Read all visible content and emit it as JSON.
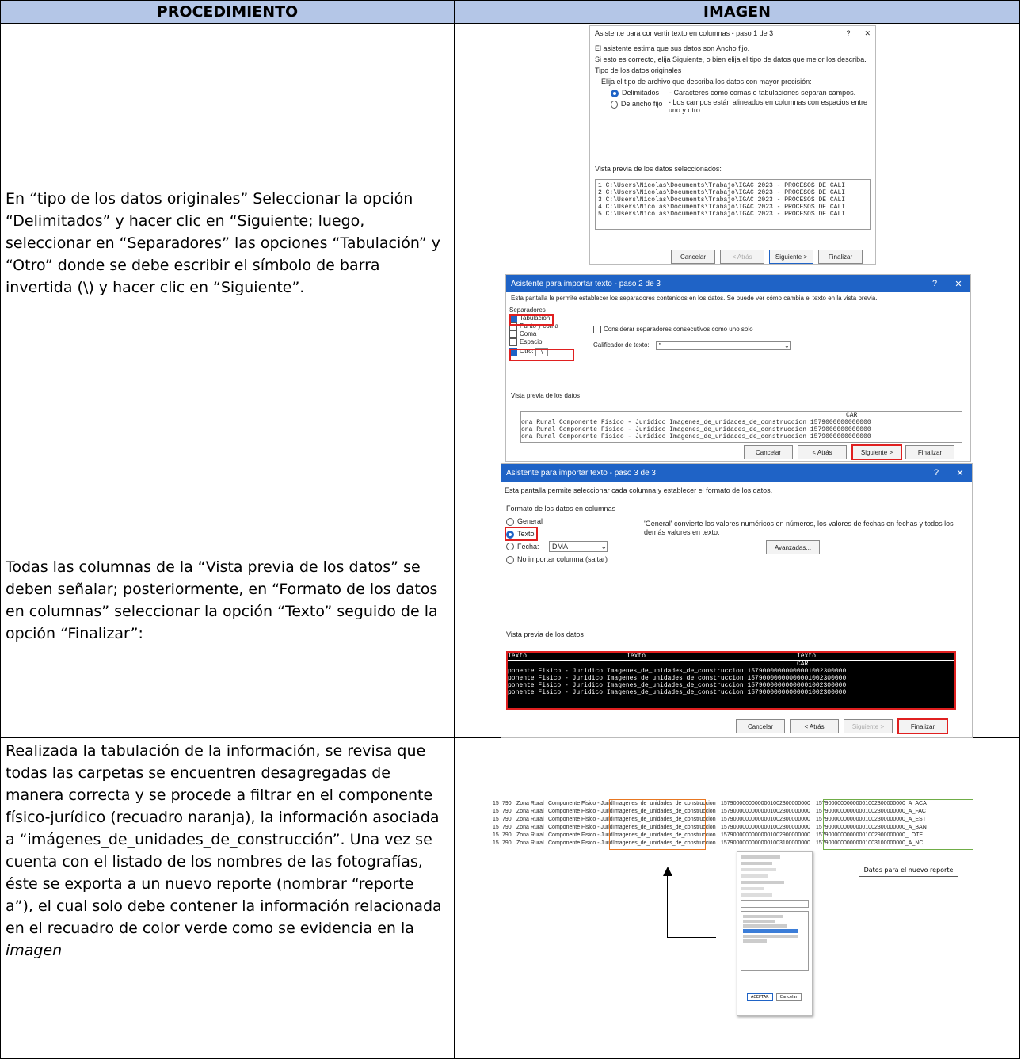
{
  "header": {
    "col1": "PROCEDIMIENTO",
    "col2": "IMAGEN"
  },
  "rows": [
    {
      "text": "En “tipo de los datos originales” Seleccionar la opción “Delimitados” y hacer clic en “Siguiente; luego, seleccionar en “Separadores” las opciones “Tabulación” y “Otro” donde se debe escribir el símbolo de barra invertida (\\) y hacer clic en “Siguiente”."
    },
    {
      "text": "Todas las columnas de la “Vista previa de los datos” se deben señalar; posteriormente, en “Formato de los datos en columnas” seleccionar la opción “Texto” seguido de la opción “Finalizar”:"
    },
    {
      "text_main": "Realizada la tabulación de la información, se revisa que todas las carpetas se encuentren desagregadas de manera correcta y se procede a filtrar en el componente físico-jurídico (recuadro naranja), la información asociada a “imágenes_de_unidades_de_construcción”. Una vez se cuenta con el listado de los nombres de las fotografías, éste se exporta a un nuevo reporte (nombrar “reporte a”), el cual solo debe contener la información relacionada en el recuadro de color verde como se evidencia en la ",
      "text_italic": "imagen"
    }
  ],
  "dlg1": {
    "title": "Asistente para convertir texto en columnas - paso 1 de 3",
    "ctl_help": "?",
    "ctl_close": "✕",
    "line1": "El asistente estima que sus datos son Ancho fijo.",
    "line2": "Si esto es correcto, elija Siguiente, o bien elija el tipo de datos que mejor los describa.",
    "group": "Tipo de los datos originales",
    "choose": "Elija el tipo de archivo que describa los datos con mayor precisión:",
    "opt1": "Delimitados",
    "opt1_desc": "- Caracteres como comas o tabulaciones separan campos.",
    "opt2": "De ancho fijo",
    "opt2_desc": "- Los campos están alineados en columnas con espacios entre uno y otro.",
    "preview": "Vista previa de los datos seleccionados:",
    "rows": [
      "1 C:\\Users\\Nicolas\\Documents\\Trabajo\\IGAC 2023 - PROCESOS DE CALI",
      "2 C:\\Users\\Nicolas\\Documents\\Trabajo\\IGAC 2023 - PROCESOS DE CALI",
      "3 C:\\Users\\Nicolas\\Documents\\Trabajo\\IGAC 2023 - PROCESOS DE CALI",
      "4 C:\\Users\\Nicolas\\Documents\\Trabajo\\IGAC 2023 - PROCESOS DE CALI",
      "5 C:\\Users\\Nicolas\\Documents\\Trabajo\\IGAC 2023 - PROCESOS DE CALI"
    ],
    "cancel": "Cancelar",
    "back": "< Atrás",
    "next": "Siguiente >",
    "finish": "Finalizar"
  },
  "dlg2": {
    "title": "Asistente para importar texto - paso 2 de 3",
    "ctl_help": "?",
    "ctl_close": "✕",
    "line1": "Esta pantalla le permite establecer los separadores contenidos en los datos. Se puede ver cómo cambia el texto en la vista previa.",
    "group": "Separadores",
    "sep": [
      "Tabulación",
      "Punto y coma",
      "Coma",
      "Espacio",
      "Otro:"
    ],
    "other_value": "\\",
    "consec": "Considerar separadores consecutivos como uno solo",
    "qual_label": "Calificador de texto:",
    "qual_value": "\"",
    "preview": "Vista previa de los datos",
    "hdr": "CAR",
    "rows": [
      "ona Rural Componente Fisico - Juridico Imagenes_de_unidades_de_construccion 1579000000000000",
      "ona Rural Componente Fisico - Juridico Imagenes_de_unidades_de_construccion 1579000000000000",
      "ona Rural Componente Fisico - Juridico Imagenes_de_unidades_de_construccion 1579000000000000",
      "ona Rural Componente Fisico - Juridico Imagenes_de_unidades_de_construccion 1579000000000000"
    ],
    "cancel": "Cancelar",
    "back": "< Atrás",
    "next": "Siguiente >",
    "finish": "Finalizar"
  },
  "dlg3": {
    "title": "Asistente para importar texto - paso 3 de 3",
    "ctl_help": "?",
    "ctl_close": "✕",
    "line1": "Esta pantalla permite seleccionar cada columna y establecer el formato de los datos.",
    "group": "Formato de los datos en columnas",
    "opts": [
      "General",
      "Texto",
      "Fecha:",
      "No importar columna (saltar)"
    ],
    "date_value": "DMA",
    "general_desc": "'General' convierte los valores numéricos en números, los valores de fechas en fechas y todos los demás valores en texto.",
    "advanced": "Avanzadas...",
    "preview": "Vista previa de los datos",
    "hdr": [
      "Texto",
      "Texto",
      "Texto"
    ],
    "hdr2": "CAR",
    "rows": [
      "ponente Fisico - Juridico Imagenes_de_unidades_de_construccion 15790000000000001002300000",
      "ponente Fisico - Juridico Imagenes_de_unidades_de_construccion 15790000000000001002300000",
      "ponente Fisico - Juridico Imagenes_de_unidades_de_construccion 15790000000000001002300000",
      "ponente Fisico - Juridico Imagenes_de_unidades_de_construccion 15790000000000001002300000"
    ],
    "cancel": "Cancelar",
    "back": "< Atrás",
    "next": "Siguiente >",
    "finish": "Finalizar"
  },
  "sheet": {
    "rows": [
      [
        "15",
        "790",
        "Zona Rural",
        "Componente Fisico - Juridico",
        "Imagenes_de_unidades_de_construccion",
        "15790000000000001002300000000",
        "15790000000000001002300000000_A_ACA"
      ],
      [
        "15",
        "790",
        "Zona Rural",
        "Componente Fisico - Juridico",
        "Imagenes_de_unidades_de_construccion",
        "15790000000000001002300000000",
        "15790000000000001002300000000_A_FAC"
      ],
      [
        "15",
        "790",
        "Zona Rural",
        "Componente Fisico - Juridico",
        "Imagenes_de_unidades_de_construccion",
        "15790000000000001002300000000",
        "15790000000000001002300000000_A_EST"
      ],
      [
        "15",
        "790",
        "Zona Rural",
        "Componente Fisico - Juridico",
        "Imagenes_de_unidades_de_construccion",
        "15790000000000001002300000000",
        "15790000000000001002300000000_A_BAN"
      ],
      [
        "15",
        "790",
        "Zona Rural",
        "Componente Fisico - Juridico",
        "Imagenes_de_unidades_de_construccion",
        "15790000000000001002900000000",
        "15790000000000001002900000000_LOTE"
      ],
      [
        "15",
        "790",
        "Zona Rural",
        "Componente Fisico - Juridico",
        "Imagenes_de_unidades_de_construccion",
        "15790000000000001003100000000",
        "15790000000000001003100000000_A_NC"
      ]
    ],
    "callout": "Datos para el nuevo reporte",
    "accept": "ACEPTAR",
    "cancel": "Cancelar"
  }
}
